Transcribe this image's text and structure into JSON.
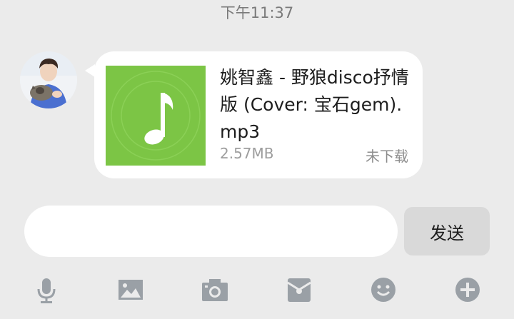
{
  "timestamp": "下午11:37",
  "message": {
    "file": {
      "name": "姚智鑫 - 野狼disco抒情版 (Cover: 宝石gem).mp3",
      "size": "2.57MB",
      "status": "未下载",
      "icon": "music-note-icon",
      "thumb_color": "#7cc545"
    }
  },
  "composer": {
    "input_value": "",
    "send_label": "发送"
  },
  "toolbar": {
    "icons": [
      "microphone-icon",
      "image-icon",
      "camera-icon",
      "red-packet-icon",
      "emoji-icon",
      "plus-icon"
    ]
  },
  "colors": {
    "background": "#ebebeb",
    "bubble": "#ffffff",
    "icon_gray": "#9aa0a6"
  }
}
